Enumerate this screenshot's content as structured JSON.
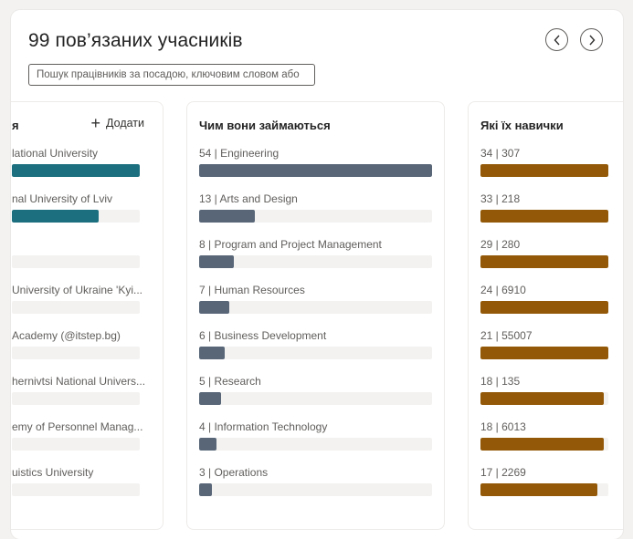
{
  "header": {
    "title": "99 пов’язаних учасників",
    "search_placeholder": "Пошук працівників за посадою, ключовим словом або",
    "prev_label": "Попередній",
    "next_label": "Наступний"
  },
  "columns": [
    {
      "title": "я",
      "add_label": "Додати",
      "color": "#1b6f7e",
      "items": [
        {
          "label": "lational University",
          "fraction": 1.0
        },
        {
          "label": "nal University of Lviv",
          "fraction": 0.68
        },
        {
          "label": "",
          "fraction": 0.0
        },
        {
          "label": "University of Ukraine 'Kyi...",
          "fraction": 0.0
        },
        {
          "label": "Academy (@itstep.bg)",
          "fraction": 0.0
        },
        {
          "label": "hernivtsi National Univers...",
          "fraction": 0.0
        },
        {
          "label": "emy of Personnel Manag...",
          "fraction": 0.0
        },
        {
          "label": "uistics University",
          "fraction": 0.0
        }
      ]
    },
    {
      "title": "Чим вони займаються",
      "color": "#586678",
      "items": [
        {
          "count": 54,
          "label": "54  | Engineering"
        },
        {
          "count": 13,
          "label": "13  | Arts and Design"
        },
        {
          "count": 8,
          "label": "8  | Program and Project Management"
        },
        {
          "count": 7,
          "label": "7  | Human Resources"
        },
        {
          "count": 6,
          "label": "6  | Business Development"
        },
        {
          "count": 5,
          "label": "5  | Research"
        },
        {
          "count": 4,
          "label": "4  | Information Technology"
        },
        {
          "count": 3,
          "label": "3  | Operations"
        }
      ]
    },
    {
      "title": "Які їх навички",
      "color": "#935908",
      "items": [
        {
          "count": 34,
          "label": "34  | 307"
        },
        {
          "count": 33,
          "label": "33  | 218"
        },
        {
          "count": 29,
          "label": "29  | 280"
        },
        {
          "count": 24,
          "label": "24  | 6910"
        },
        {
          "count": 21,
          "label": "21  | 55007"
        },
        {
          "count": 18,
          "label": "18  | 135"
        },
        {
          "count": 18,
          "label": "18  | 6013"
        },
        {
          "count": 17,
          "label": "17  | 2269"
        }
      ]
    }
  ]
}
